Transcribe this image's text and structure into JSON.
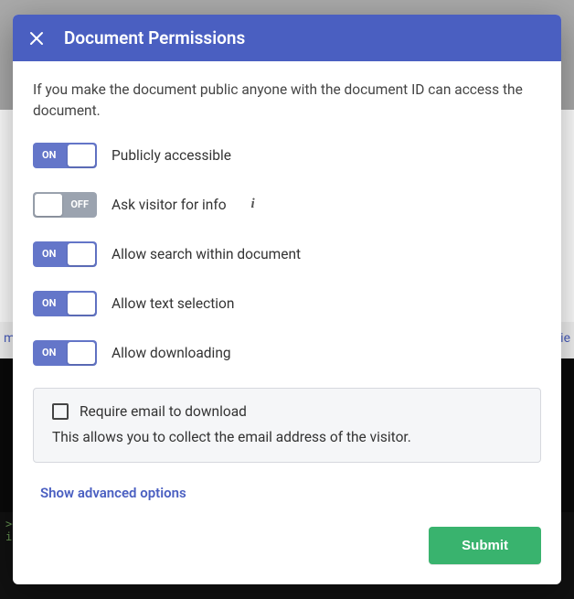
{
  "modal": {
    "title": "Document Permissions",
    "description": "If you make the document public anyone with the document ID can access the document.",
    "toggles": [
      {
        "state": "ON",
        "on": true,
        "label": "Publicly accessible"
      },
      {
        "state": "OFF",
        "on": false,
        "label": "Ask visitor for info",
        "has_info": true
      },
      {
        "state": "ON",
        "on": true,
        "label": "Allow search within document"
      },
      {
        "state": "ON",
        "on": true,
        "label": "Allow text selection"
      },
      {
        "state": "ON",
        "on": true,
        "label": "Allow downloading"
      }
    ],
    "sub_panel": {
      "checkbox_label": "Require email to download",
      "checkbox_checked": false,
      "description": "This allows you to collect the email address of the visitor."
    },
    "advanced_link": "Show advanced options",
    "submit_label": "Submit"
  }
}
